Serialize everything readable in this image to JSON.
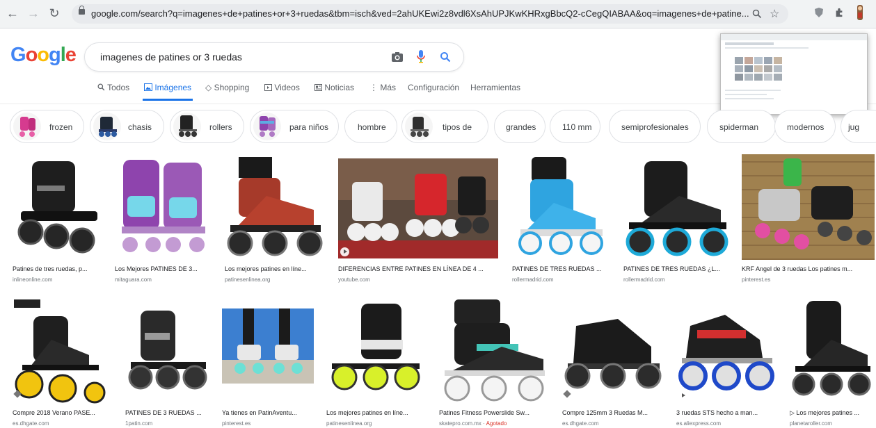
{
  "browser": {
    "url": "google.com/search?q=imagenes+de+patines+or+3+ruedas&tbm=isch&ved=2ahUKEwi2z8vdl6XsAhUPJKwKHRxgBbcQ2-cCegQIABAA&oq=imagenes+de+patine..."
  },
  "logo": [
    "G",
    "o",
    "o",
    "g",
    "l",
    "e"
  ],
  "logo_colors": [
    "#4285f4",
    "#ea4335",
    "#fbbc05",
    "#4285f4",
    "#34a853",
    "#ea4335"
  ],
  "search": {
    "query": "imagenes de patines or 3 ruedas"
  },
  "tabs": {
    "todos": "Todos",
    "imagenes": "Imágenes",
    "shopping": "Shopping",
    "videos": "Videos",
    "noticias": "Noticias",
    "mas": "Más",
    "configuracion": "Configuración",
    "herramientas": "Herramientas"
  },
  "chips": [
    "frozen",
    "chasis",
    "rollers",
    "para niños",
    "hombre",
    "tipos de",
    "grandes",
    "110 mm",
    "semiprofesionales",
    "spiderman",
    "modernos",
    "jug"
  ],
  "results_row1": [
    {
      "title": "Patines de tres ruedas, p...",
      "source": "inlineonline.com"
    },
    {
      "title": "Los Mejores PATINES DE 3...",
      "source": "mitaguara.com"
    },
    {
      "title": "Los mejores patines en líne...",
      "source": "patinesenlinea.org"
    },
    {
      "title": "DIFERENCIAS ENTRE PATINES EN LÍNEA DE 4 ...",
      "source": "youtube.com"
    },
    {
      "title": "PATINES DE TRES RUEDAS ...",
      "source": "rollermadrid.com"
    },
    {
      "title": "PATINES DE TRES RUEDAS ¿L...",
      "source": "rollermadrid.com"
    },
    {
      "title": "KRF Angel de 3 ruedas Los patines m...",
      "source": "pinterest.es"
    }
  ],
  "results_row2": [
    {
      "title": "Compre 2018 Verano PASE...",
      "source": "es.dhgate.com"
    },
    {
      "title": "PATINES DE 3 RUEDAS ...",
      "source": "1patin.com"
    },
    {
      "title": "Ya tienes en PatinAventu...",
      "source": "pinterest.es"
    },
    {
      "title": "Los mejores patines en líne...",
      "source": "patinesenlinea.org"
    },
    {
      "title": "Patines Fitness Powerslide Sw...",
      "source": "skatepro.com.mx",
      "status": "Agotado"
    },
    {
      "title": "Compre 125mm 3 Ruedas M...",
      "source": "es.dhgate.com"
    },
    {
      "title": "3 ruedas STS hecho a man...",
      "source": "es.aliexpress.com"
    },
    {
      "title": "▷ Los mejores patines ...",
      "source": "planetaroller.com"
    }
  ],
  "colors": {
    "accent": "#1a73e8",
    "source_gray": "#70757a",
    "status_red": "#d93025"
  }
}
